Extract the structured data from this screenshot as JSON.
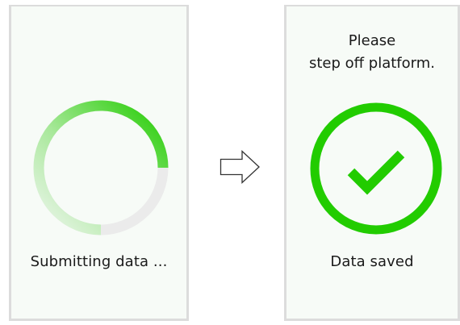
{
  "left_panel": {
    "status": "Submitting data ...",
    "progress": 0.75
  },
  "right_panel": {
    "prompt_line_1": "Please",
    "prompt_line_2": "step off platform.",
    "status": "Data saved"
  },
  "colors": {
    "accent_green": "#22cc00",
    "track_gray": "#ebebeb",
    "panel_bg": "#f7fbf7"
  },
  "icons": {
    "spinner": "loading-spinner-icon",
    "transition": "right-arrow-icon",
    "success": "checkmark-circle-icon"
  }
}
